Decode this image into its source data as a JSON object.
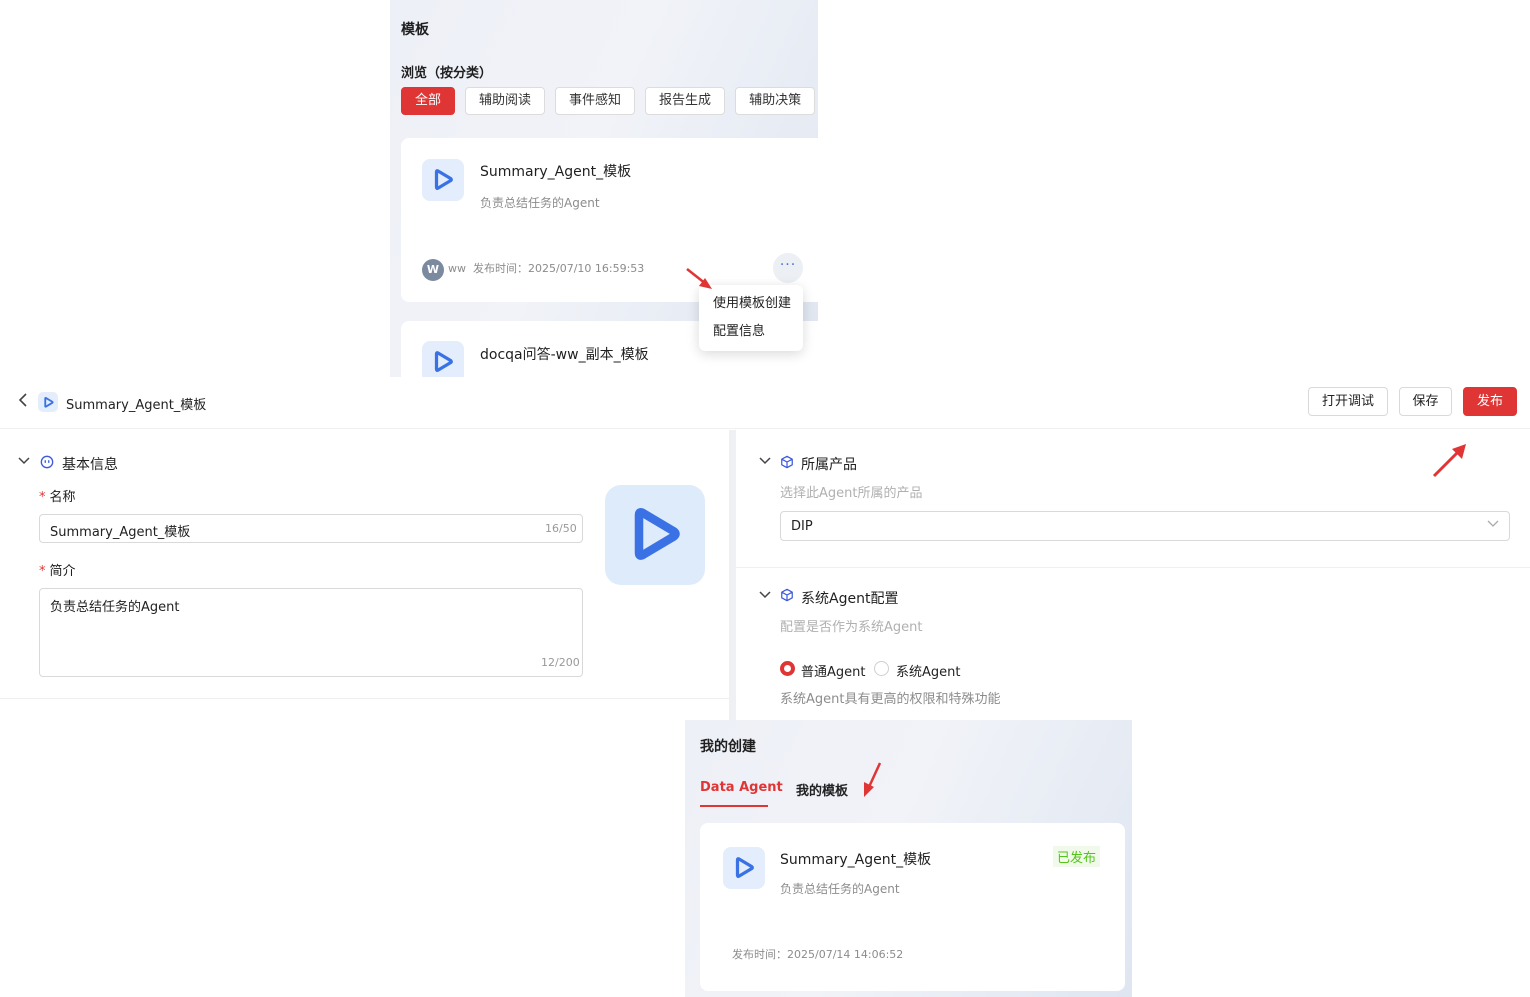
{
  "templates_panel": {
    "title": "模板",
    "browse_label": "浏览（按分类）",
    "categories": [
      "全部",
      "辅助阅读",
      "事件感知",
      "报告生成",
      "辅助决策"
    ],
    "cards": [
      {
        "name": "Summary_Agent_模板",
        "desc": "负责总结任务的Agent",
        "author_initial": "W",
        "author": "ww",
        "publish_time": "发布时间：2025/07/10 16:59:53",
        "more_glyph": "···"
      },
      {
        "name": "docqa问答-ww_副本_模板"
      }
    ],
    "context_menu": [
      "使用模板创建",
      "配置信息"
    ]
  },
  "editor": {
    "back_glyph": "<",
    "title": "Summary_Agent_模板",
    "buttons": {
      "debug": "打开调试",
      "save": "保存",
      "publish": "发布"
    },
    "basic_info": {
      "section": "基本信息",
      "name_label": "名称",
      "name_value": "Summary_Agent_模板",
      "name_counter": "16/50",
      "intro_label": "简介",
      "intro_value": "负责总结任务的Agent",
      "intro_counter": "12/200",
      "required_mark": "*"
    },
    "product": {
      "section": "所属产品",
      "hint": "选择此Agent所属的产品",
      "value": "DIP"
    },
    "system_agent": {
      "section": "系统Agent配置",
      "hint": "配置是否作为系统Agent",
      "options": [
        "普通Agent",
        "系统Agent"
      ],
      "selected": "普通Agent",
      "note": "系统Agent具有更高的权限和特殊功能"
    }
  },
  "my_panel": {
    "title": "我的创建",
    "tabs": [
      "Data Agent",
      "我的模板"
    ],
    "active_tab": "Data Agent",
    "card": {
      "name": "Summary_Agent_模板",
      "desc": "负责总结任务的Agent",
      "status": "已发布",
      "publish_time": "发布时间：2025/07/14 14:06:52"
    }
  },
  "colors": {
    "accent": "#e03535",
    "logo_blue": "#3a72e6",
    "success": "#52c41a"
  },
  "icons": [
    "play-logo-icon",
    "chevron-left-icon",
    "chevron-down-icon",
    "robot-icon",
    "cube-icon",
    "red-arrow-icon"
  ]
}
